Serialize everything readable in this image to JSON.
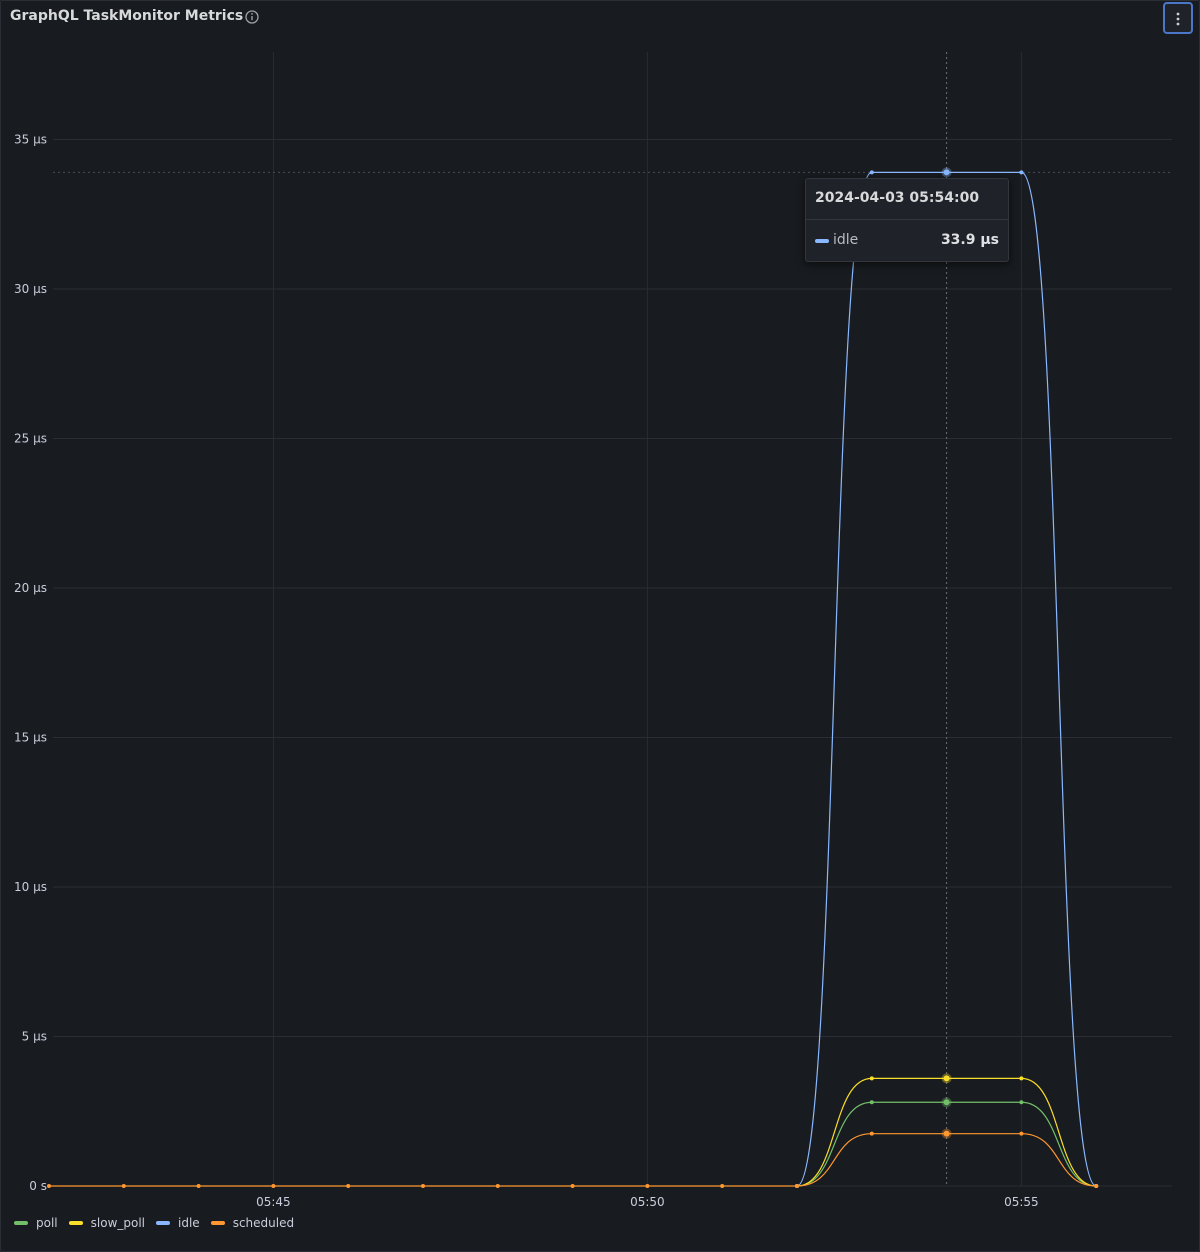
{
  "panel": {
    "title": "GraphQL TaskMonitor Metrics"
  },
  "tooltip": {
    "time": "2024-04-03 05:54:00",
    "series": "idle",
    "value": "33.9 µs",
    "color": "#8ab8ff"
  },
  "chart_data": {
    "type": "line",
    "title": "GraphQL TaskMonitor Metrics",
    "xlabel": "",
    "ylabel": "",
    "x": [
      "05:42",
      "05:43",
      "05:44",
      "05:45",
      "05:46",
      "05:47",
      "05:48",
      "05:49",
      "05:50",
      "05:51",
      "05:52",
      "05:53",
      "05:54",
      "05:55",
      "05:56"
    ],
    "y_ticks": [
      "0 s",
      "5 µs",
      "10 µs",
      "15 µs",
      "20 µs",
      "25 µs",
      "30 µs",
      "35 µs"
    ],
    "x_ticks": [
      "05:45",
      "05:50",
      "05:55"
    ],
    "ylim": [
      0,
      35
    ],
    "grid": true,
    "legend": "bottom-left",
    "series": [
      {
        "name": "poll",
        "color": "#73bf69",
        "values": [
          null,
          null,
          null,
          null,
          null,
          null,
          null,
          null,
          null,
          null,
          0,
          2.8,
          2.8,
          2.8,
          0
        ]
      },
      {
        "name": "slow_poll",
        "color": "#fade2a",
        "values": [
          null,
          null,
          null,
          null,
          null,
          null,
          null,
          null,
          null,
          null,
          0,
          3.6,
          3.6,
          3.6,
          0
        ]
      },
      {
        "name": "idle",
        "color": "#8ab8ff",
        "values": [
          null,
          null,
          null,
          null,
          null,
          null,
          null,
          null,
          null,
          null,
          0,
          33.9,
          33.9,
          33.9,
          0
        ]
      },
      {
        "name": "scheduled",
        "color": "#ff9830",
        "values": [
          0,
          0,
          0,
          0,
          0,
          0,
          0,
          0,
          0,
          0,
          0,
          1.75,
          1.75,
          1.75,
          0
        ]
      }
    ]
  }
}
